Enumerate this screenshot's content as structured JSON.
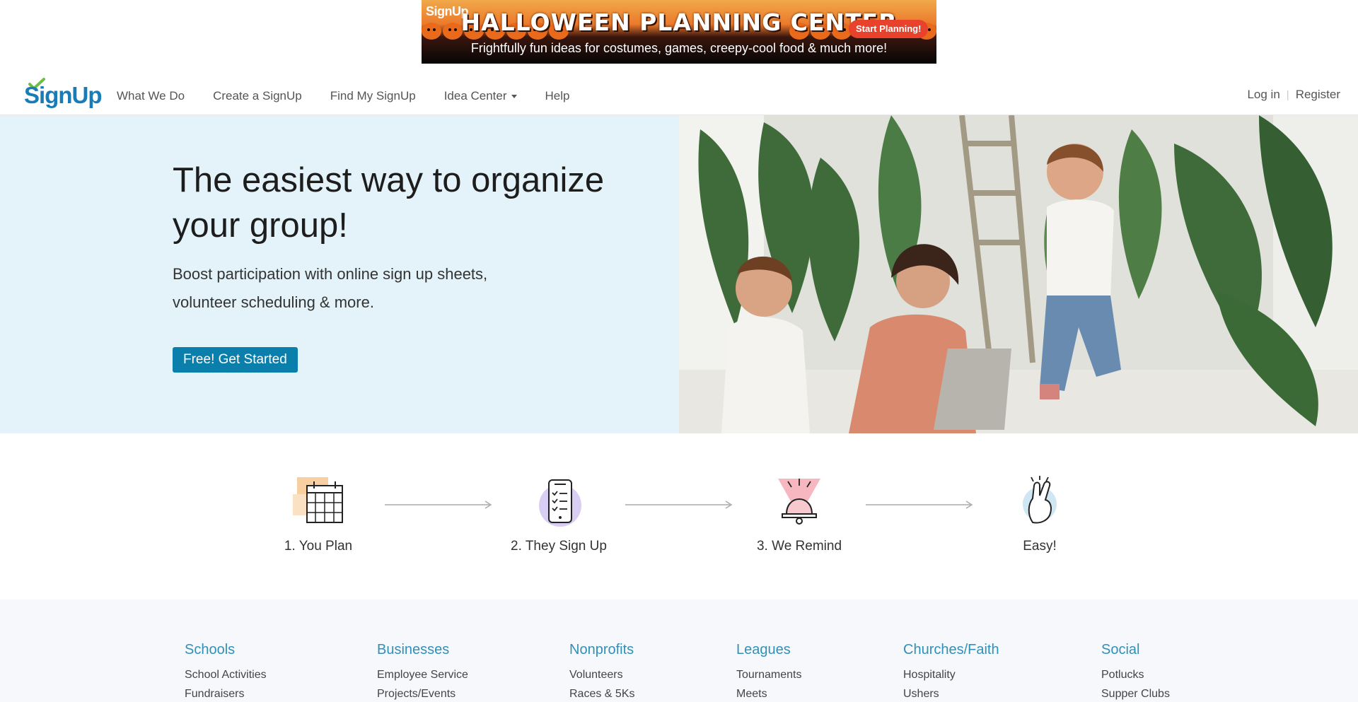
{
  "banner": {
    "logo": "SignUp",
    "title": "HALLOWEEN PLANNING CENTER",
    "cta": "Start Planning!",
    "subtitle": "Frightfully fun ideas for costumes, games, creepy-cool food & much more!"
  },
  "header": {
    "logo_text": "SignUp",
    "nav": [
      {
        "label": "What We Do"
      },
      {
        "label": "Create a SignUp"
      },
      {
        "label": "Find My SignUp"
      },
      {
        "label": "Idea Center",
        "has_dropdown": true
      },
      {
        "label": "Help"
      }
    ],
    "login": "Log in",
    "register": "Register"
  },
  "hero": {
    "title": "The easiest way to organize your group!",
    "subtitle": "Boost participation with online sign up sheets, volunteer scheduling & more.",
    "cta": "Free! Get Started"
  },
  "steps": [
    {
      "label": "1. You Plan",
      "icon": "calendar-icon"
    },
    {
      "label": "2. They Sign Up",
      "icon": "phone-checklist-icon"
    },
    {
      "label": "3. We Remind",
      "icon": "bell-icon"
    },
    {
      "label": "Easy!",
      "icon": "fingers-crossed-icon"
    }
  ],
  "categories": [
    {
      "title": "Schools",
      "links": [
        "School Activities",
        "Fundraisers"
      ]
    },
    {
      "title": "Businesses",
      "links": [
        "Employee Service",
        "Projects/Events"
      ]
    },
    {
      "title": "Nonprofits",
      "links": [
        "Volunteers",
        "Races & 5Ks"
      ]
    },
    {
      "title": "Leagues",
      "links": [
        "Tournaments",
        "Meets"
      ]
    },
    {
      "title": "Churches/Faith",
      "links": [
        "Hospitality",
        "Ushers"
      ]
    },
    {
      "title": "Social",
      "links": [
        "Potlucks",
        "Supper Clubs"
      ]
    }
  ],
  "colors": {
    "brand_blue": "#1a7cb6",
    "cta_blue": "#0b7fab",
    "hero_bg": "#e3f3f9",
    "category_title": "#3190b7",
    "banner_cta": "#e8412c"
  }
}
